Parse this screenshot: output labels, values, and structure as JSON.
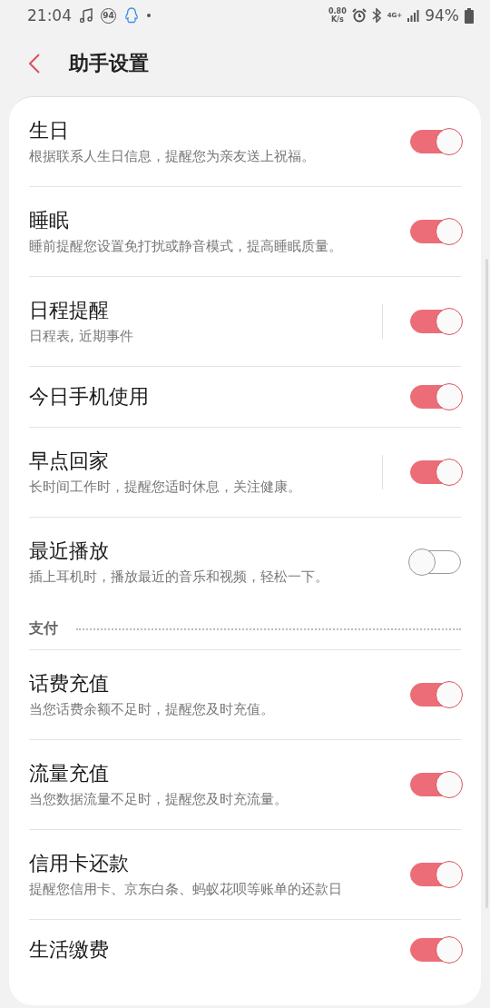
{
  "status_bar": {
    "time": "21:04",
    "notification_badge": "94",
    "net_speed_value": "0.80",
    "net_speed_unit": "K/s",
    "network": "4G+",
    "battery": "94%"
  },
  "header": {
    "title": "助手设置"
  },
  "items": [
    {
      "kind": "toggle",
      "title": "生日",
      "subtitle": "根据联系人生日信息，提醒您为亲友送上祝福。",
      "on": true
    },
    {
      "kind": "toggle",
      "title": "睡眠",
      "subtitle": "睡前提醒您设置免打扰或静音模式，提高睡眠质量。",
      "on": true
    },
    {
      "kind": "toggle_link",
      "title": "日程提醒",
      "subtitle": "日程表, 近期事件",
      "on": true
    },
    {
      "kind": "toggle",
      "title": "今日手机使用",
      "on": true
    },
    {
      "kind": "toggle_link",
      "title": "早点回家",
      "subtitle": "长时间工作时，提醒您适时休息，关注健康。",
      "on": true
    },
    {
      "kind": "toggle",
      "title": "最近播放",
      "subtitle": "插上耳机时，播放最近的音乐和视频，轻松一下。",
      "on": false
    },
    {
      "kind": "section",
      "title": "支付"
    },
    {
      "kind": "toggle",
      "title": "话费充值",
      "subtitle": "当您话费余额不足时，提醒您及时充值。",
      "on": true
    },
    {
      "kind": "toggle",
      "title": "流量充值",
      "subtitle": "当您数据流量不足时，提醒您及时充流量。",
      "on": true
    },
    {
      "kind": "toggle",
      "title": "信用卡还款",
      "subtitle": "提醒您信用卡、京东白条、蚂蚁花呗等账单的还款日",
      "on": true
    },
    {
      "kind": "toggle",
      "title": "生活缴费",
      "on": true
    }
  ]
}
